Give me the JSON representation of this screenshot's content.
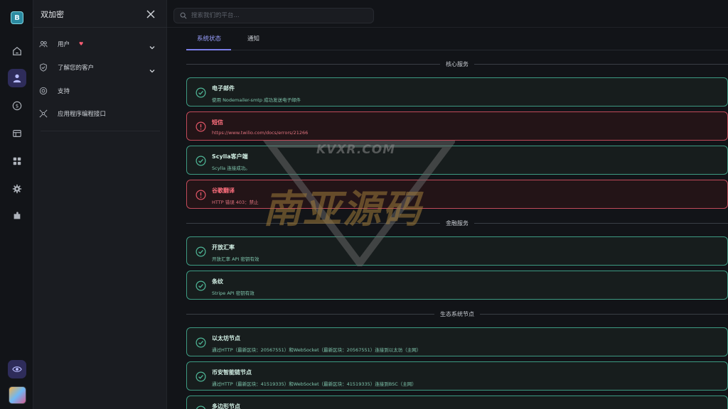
{
  "app": {
    "logo_text": "B"
  },
  "rail": {
    "items": [
      "home-icon",
      "user-icon",
      "dollar-icon",
      "table-icon",
      "grid-icon",
      "gear-icon",
      "puzzle-icon"
    ],
    "active": "user-icon"
  },
  "panel": {
    "title": "双加密",
    "menu": [
      {
        "label": "用户",
        "badge": "♥"
      },
      {
        "label": "了解您的客户"
      },
      {
        "label": "支持"
      },
      {
        "label": "应用程序编程接口"
      }
    ]
  },
  "search": {
    "placeholder": "搜索我们的平台..."
  },
  "tabs": [
    {
      "label": "系统状态",
      "active": true
    },
    {
      "label": "通知",
      "active": false
    }
  ],
  "sections": {
    "core": {
      "label": "核心服务"
    },
    "finance": {
      "label": "金融服务"
    },
    "ecosystem": {
      "label": "生态系统节点"
    }
  },
  "cards": [
    {
      "status": "ok",
      "title": "电子邮件",
      "desc": "使用 Nodemailer-smtp 成功发送电子邮件"
    },
    {
      "status": "error",
      "title": "短信",
      "desc": "https://www.twilio.com/docs/errors/21266"
    },
    {
      "status": "ok",
      "title": "Scylla客户端",
      "desc": "Scylla 连接成功。"
    },
    {
      "status": "error",
      "title": "谷歌翻译",
      "desc": "HTTP 错误 403：禁止"
    },
    {
      "status": "ok",
      "title": "开放汇率",
      "desc": "开放汇率 API 密钥有效"
    },
    {
      "status": "ok",
      "title": "条纹",
      "desc": "Stripe API 密钥有效"
    },
    {
      "status": "ok",
      "title": "以太坊节点",
      "desc": "通过HTTP（最新区块：20567551）和WebSocket（最新区块：20567551）连接到以太坊（主网）"
    },
    {
      "status": "ok",
      "title": "币安智能链节点",
      "desc": "通过HTTP（最新区块：41519335）和WebSocket（最新区块：41519335）连接到BSC（主网）"
    },
    {
      "status": "ok",
      "title": "多边形节点",
      "desc": ""
    }
  ],
  "watermark": {
    "top": "KVXR.COM",
    "main": "南亚源码"
  },
  "colors": {
    "accent": "#7b7ee8",
    "ok": "#3d9a82",
    "error": "#c24b5a"
  }
}
